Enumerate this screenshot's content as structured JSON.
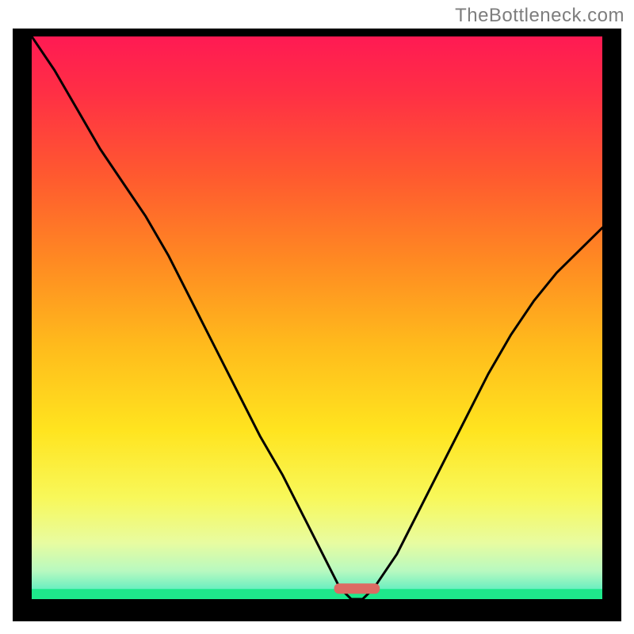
{
  "watermark": "TheBottleneck.com",
  "accent_colors": {
    "curve": "#000000",
    "frame": "#000000",
    "marker": "#dc6b63",
    "green_band": "#1ee88b"
  },
  "chart_data": {
    "type": "line",
    "title": "",
    "xlabel": "",
    "ylabel": "",
    "xlim": [
      0,
      100
    ],
    "ylim": [
      0,
      100
    ],
    "x": [
      0,
      4,
      8,
      12,
      16,
      20,
      24,
      28,
      32,
      36,
      40,
      44,
      48,
      52,
      54,
      56,
      58,
      60,
      64,
      68,
      72,
      76,
      80,
      84,
      88,
      92,
      96,
      100
    ],
    "series": [
      {
        "name": "bottleneck-curve",
        "values": [
          100,
          94,
          87,
          80,
          74,
          68,
          61,
          53,
          45,
          37,
          29,
          22,
          14,
          6,
          2,
          0,
          0,
          2,
          8,
          16,
          24,
          32,
          40,
          47,
          53,
          58,
          62,
          66
        ]
      }
    ],
    "marker": {
      "x_center": 57,
      "half_width": 4,
      "y": 0,
      "color": "#dc6b63"
    },
    "gradient_stops": [
      {
        "offset": 0.0,
        "color": "#ff1a53"
      },
      {
        "offset": 0.1,
        "color": "#ff2f45"
      },
      {
        "offset": 0.25,
        "color": "#ff5a2f"
      },
      {
        "offset": 0.4,
        "color": "#ff8a22"
      },
      {
        "offset": 0.55,
        "color": "#ffbb1c"
      },
      {
        "offset": 0.7,
        "color": "#ffe41f"
      },
      {
        "offset": 0.82,
        "color": "#f8f85a"
      },
      {
        "offset": 0.9,
        "color": "#e8fca0"
      },
      {
        "offset": 0.95,
        "color": "#b8f9c0"
      },
      {
        "offset": 0.985,
        "color": "#63eec0"
      },
      {
        "offset": 1.0,
        "color": "#1ee88b"
      }
    ]
  }
}
